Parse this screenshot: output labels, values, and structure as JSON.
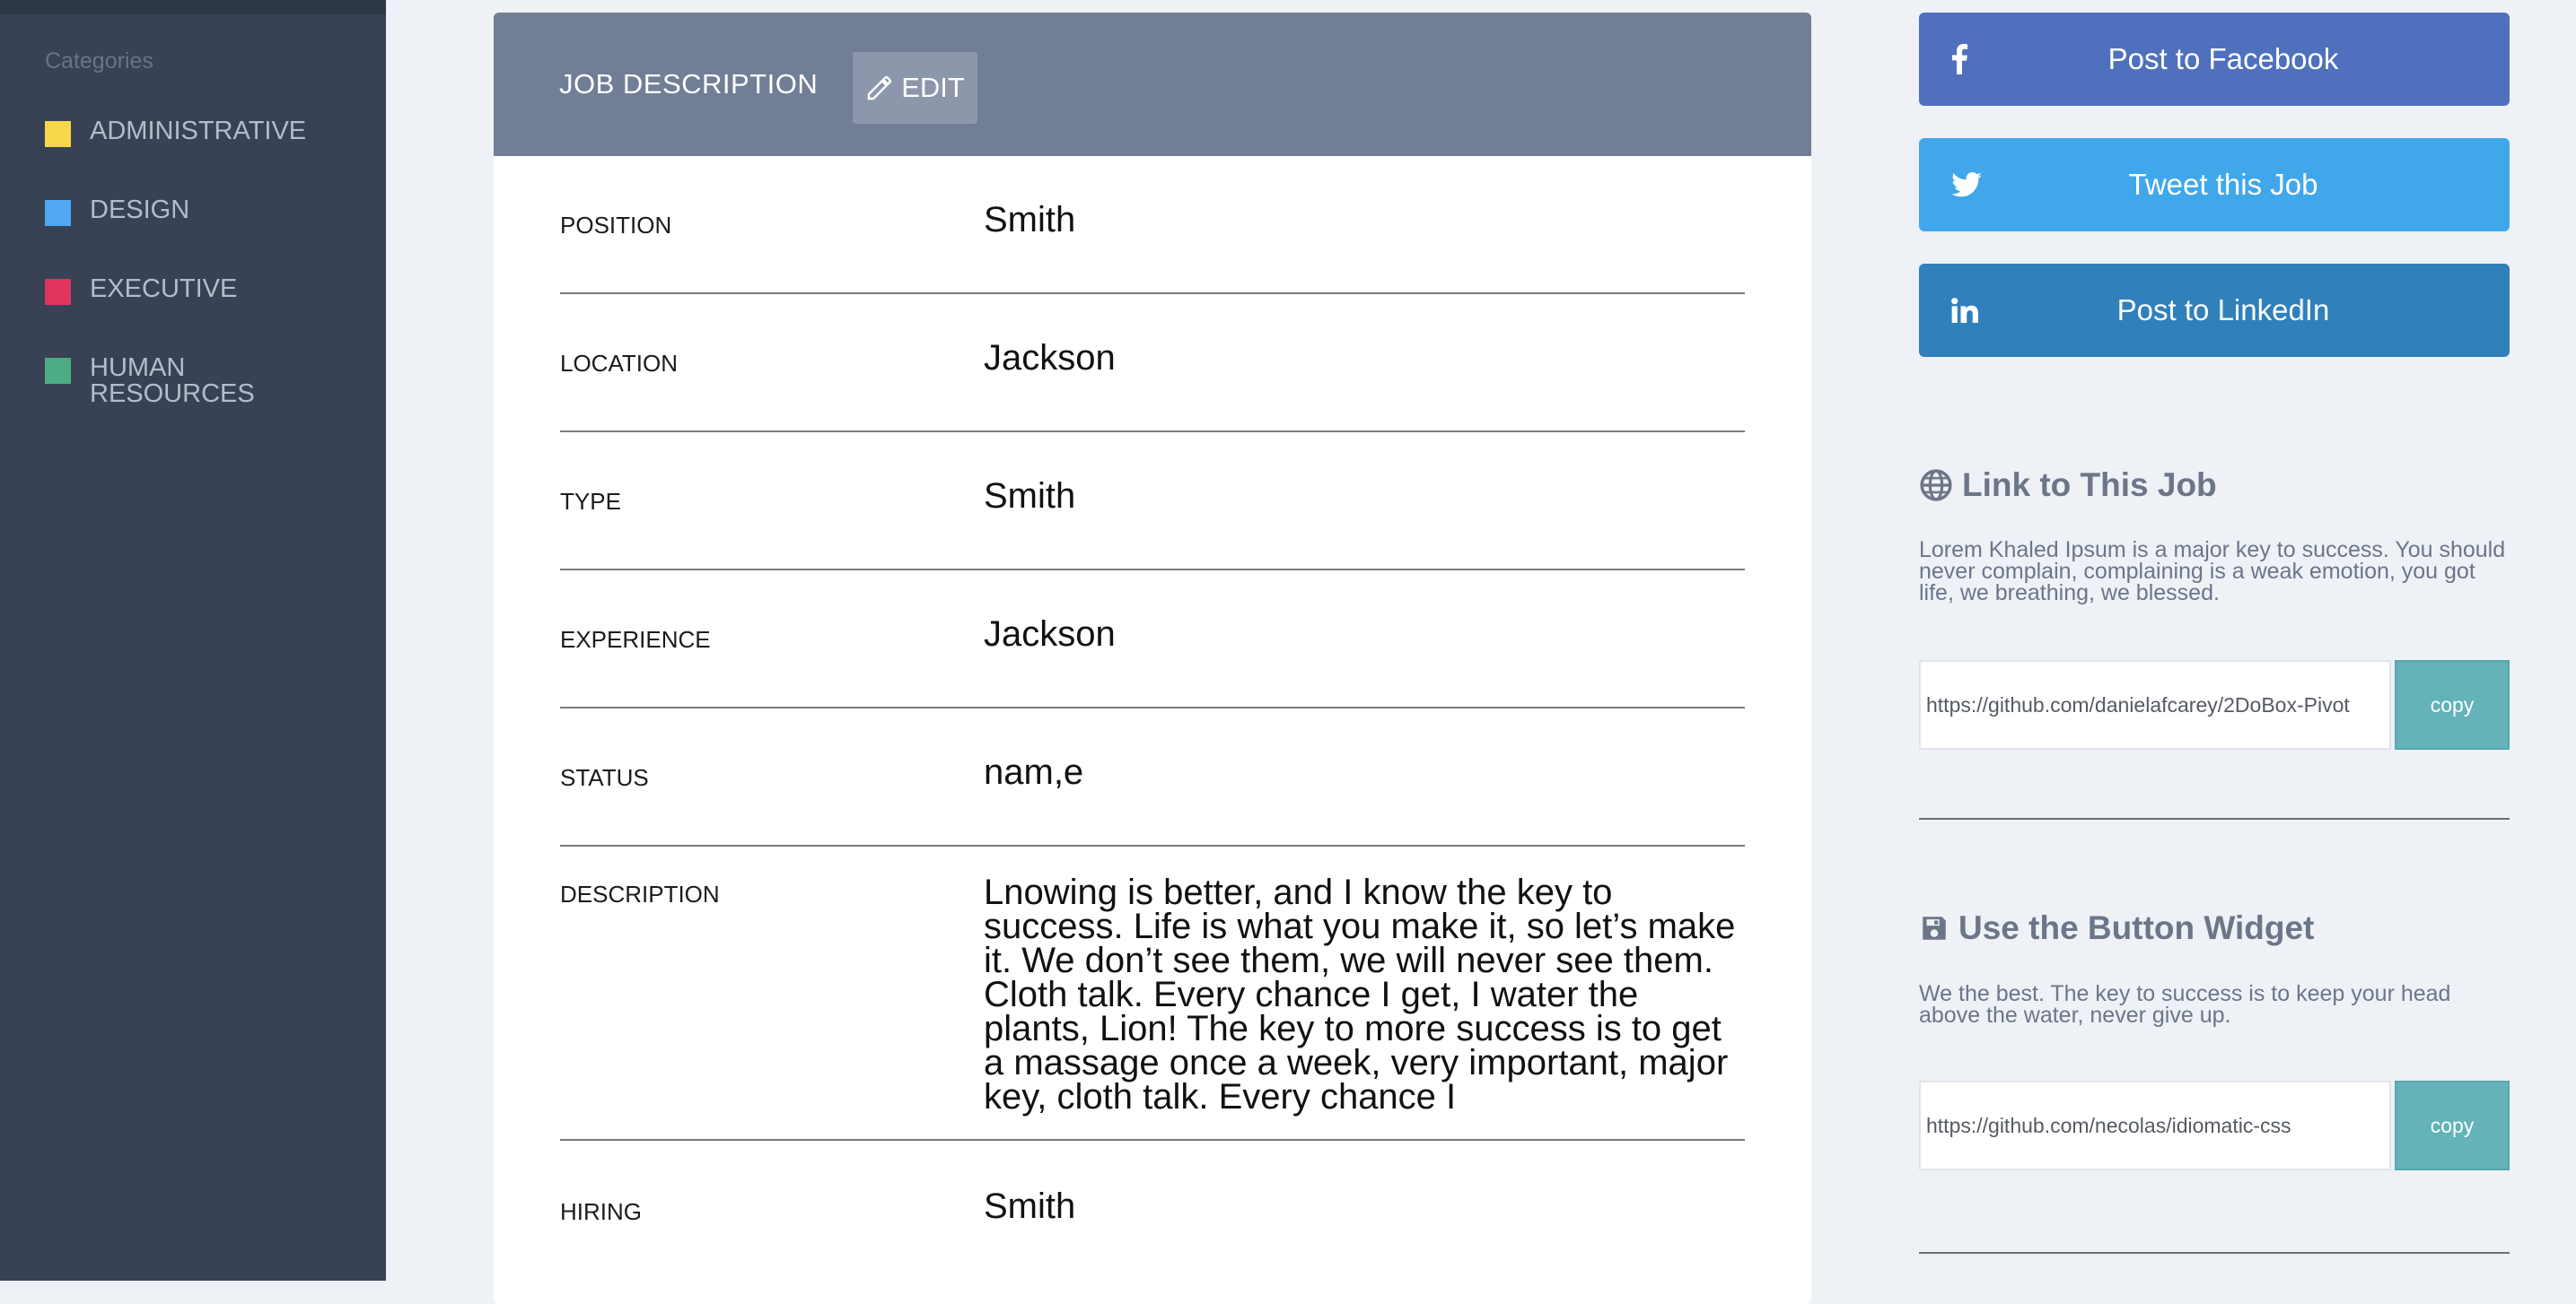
{
  "sidebar": {
    "heading": "Categories",
    "categories": [
      {
        "label": "ADMINISTRATIVE",
        "color": "#f7d84a"
      },
      {
        "label": "DESIGN",
        "color": "#50a9f2"
      },
      {
        "label": "EXECUTIVE",
        "color": "#e0355f"
      },
      {
        "label": "HUMAN RESOURCES",
        "color": "#4cac84"
      }
    ]
  },
  "job": {
    "header_title": "JOB DESCRIPTION",
    "edit_label": "EDIT",
    "rows": [
      {
        "label": "POSITION",
        "value": "Smith"
      },
      {
        "label": "LOCATION",
        "value": "Jackson"
      },
      {
        "label": "TYPE",
        "value": "Smith"
      },
      {
        "label": "EXPERIENCE",
        "value": "Jackson"
      },
      {
        "label": "STATUS",
        "value": "nam,e"
      },
      {
        "label": "DESCRIPTION",
        "value": "Lnowing is better, and I know the key to success. Life is what you make it, so let’s make it. We don’t see them, we will never see them. Cloth talk. Every chance I get, I water the plants, Lion! The key to more success is to get a massage once a week, very important, major key, cloth talk. Every chance I"
      },
      {
        "label": "HIRING",
        "value": "Smith"
      }
    ]
  },
  "share": {
    "facebook": {
      "label": "Post to Facebook",
      "icon": "facebook-icon",
      "color": "#4f70bd"
    },
    "twitter": {
      "label": "Tweet this Job",
      "icon": "twitter-icon",
      "color": "#40a8ea"
    },
    "linkedin": {
      "label": "Post to LinkedIn",
      "icon": "linkedin-icon",
      "color": "#2f80bb"
    }
  },
  "link_section": {
    "title": "Link to This Job",
    "icon": "globe-icon",
    "text": "Lorem Khaled Ipsum is a major key to success. You should never complain, complaining is a weak emotion, you got life, we breathing, we blessed.",
    "url": "https://github.com/danielafcarey/2DoBox-Pivot",
    "copy_label": "copy"
  },
  "widget_section": {
    "title": "Use the Button Widget",
    "icon": "save-icon",
    "text": "We the best. The key to success is to keep your head above the water, never give up.",
    "url": "https://github.com/necolas/idiomatic-css",
    "copy_label": "copy"
  },
  "colors": {
    "sidebar_bg": "#384254",
    "card_header_bg": "#717e95",
    "copy_button": "#63b3b8"
  }
}
